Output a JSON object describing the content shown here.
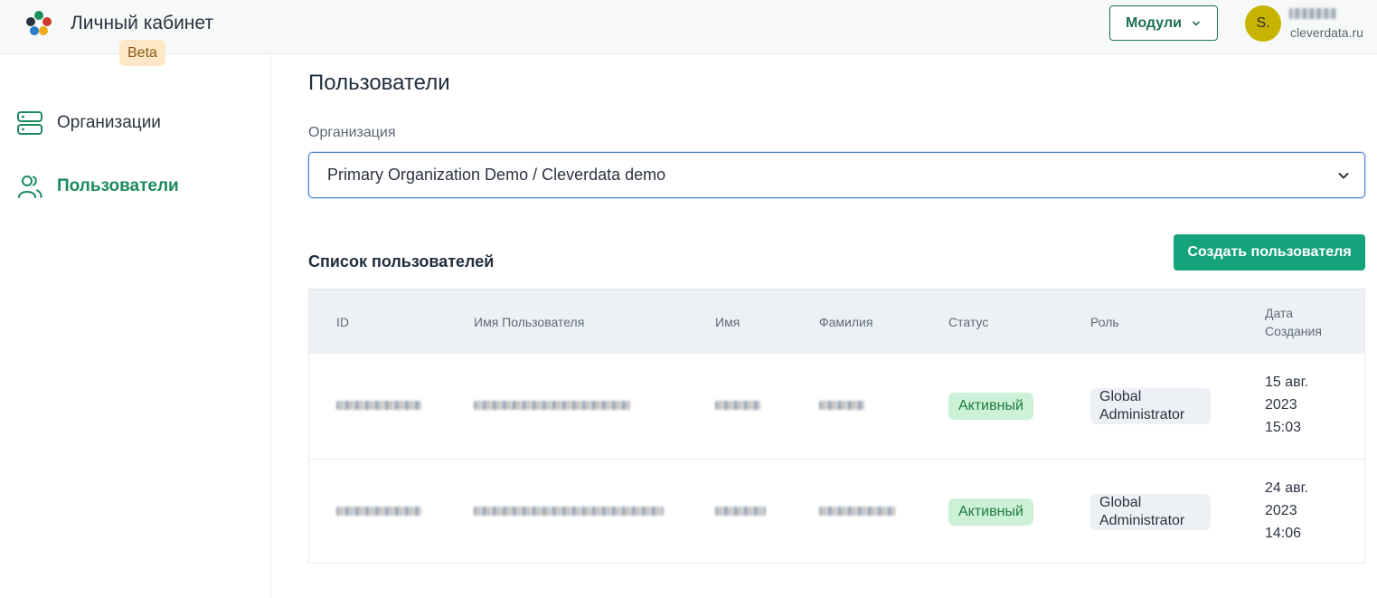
{
  "header": {
    "app_title": "Личный кабинет",
    "beta_label": "Beta",
    "modules_label": "Модули",
    "avatar_initial": "S.",
    "user_domain": "cleverdata.ru"
  },
  "sidebar": {
    "items": [
      {
        "label": "Организации",
        "icon": "server-icon",
        "active": false
      },
      {
        "label": "Пользователи",
        "icon": "users-icon",
        "active": true
      }
    ]
  },
  "main": {
    "page_title": "Пользователи",
    "org_field_label": "Организация",
    "org_selected": "Primary Organization Demo / Cleverdata demo",
    "list_title": "Список пользователей",
    "create_button_label": "Создать пользователя",
    "table": {
      "headers": [
        "ID",
        "Имя Пользователя",
        "Имя",
        "Фамилия",
        "Статус",
        "Роль",
        "Дата Создания"
      ],
      "rows": [
        {
          "status": "Активный",
          "role": "Global Administrator",
          "date_day": "15 авг.",
          "date_year": "2023",
          "date_time": "15:03"
        },
        {
          "status": "Активный",
          "role": "Global Administrator",
          "date_day": "24 авг.",
          "date_year": "2023",
          "date_time": "14:06"
        }
      ]
    }
  },
  "colors": {
    "accent_green": "#14a37a",
    "nav_active": "#1c8a5e",
    "status_bg": "#cdf1d6",
    "avatar_bg": "#c7b400"
  }
}
